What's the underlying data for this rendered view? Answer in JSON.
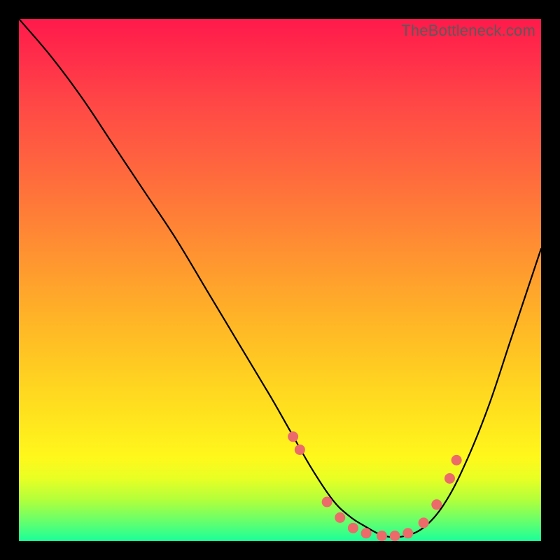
{
  "watermark": "TheBottleneck.com",
  "colors": {
    "background": "#000000",
    "gradient_top": "#ff1a4b",
    "gradient_mid": "#ffe31e",
    "gradient_bottom": "#1aff9a",
    "curve_stroke": "#000000",
    "marker_fill": "#ec6a6a"
  },
  "chart_data": {
    "type": "line",
    "title": "",
    "xlabel": "",
    "ylabel": "",
    "xlim": [
      0,
      100
    ],
    "ylim": [
      0,
      100
    ],
    "grid": false,
    "legend_position": "none",
    "annotations": [
      "TheBottleneck.com"
    ],
    "series": [
      {
        "name": "curve",
        "x": [
          0,
          6,
          12,
          18,
          24,
          30,
          36,
          42,
          48,
          52,
          56,
          60,
          63,
          66,
          70,
          74,
          78,
          82,
          86,
          90,
          94,
          98,
          100
        ],
        "y": [
          100,
          93,
          85,
          76,
          67,
          58,
          48,
          38,
          28,
          21,
          14,
          8,
          5,
          3,
          1,
          1,
          3,
          8,
          16,
          26,
          38,
          50,
          56
        ]
      }
    ],
    "markers": {
      "name": "highlighted-points",
      "x": [
        52.5,
        53.8,
        59.0,
        61.5,
        64.0,
        66.5,
        69.5,
        72.0,
        74.5,
        77.5,
        80.0,
        82.5,
        83.8
      ],
      "y": [
        20.0,
        17.5,
        7.5,
        4.5,
        2.5,
        1.5,
        1.0,
        1.0,
        1.5,
        3.5,
        7.0,
        12.0,
        15.5
      ]
    }
  }
}
